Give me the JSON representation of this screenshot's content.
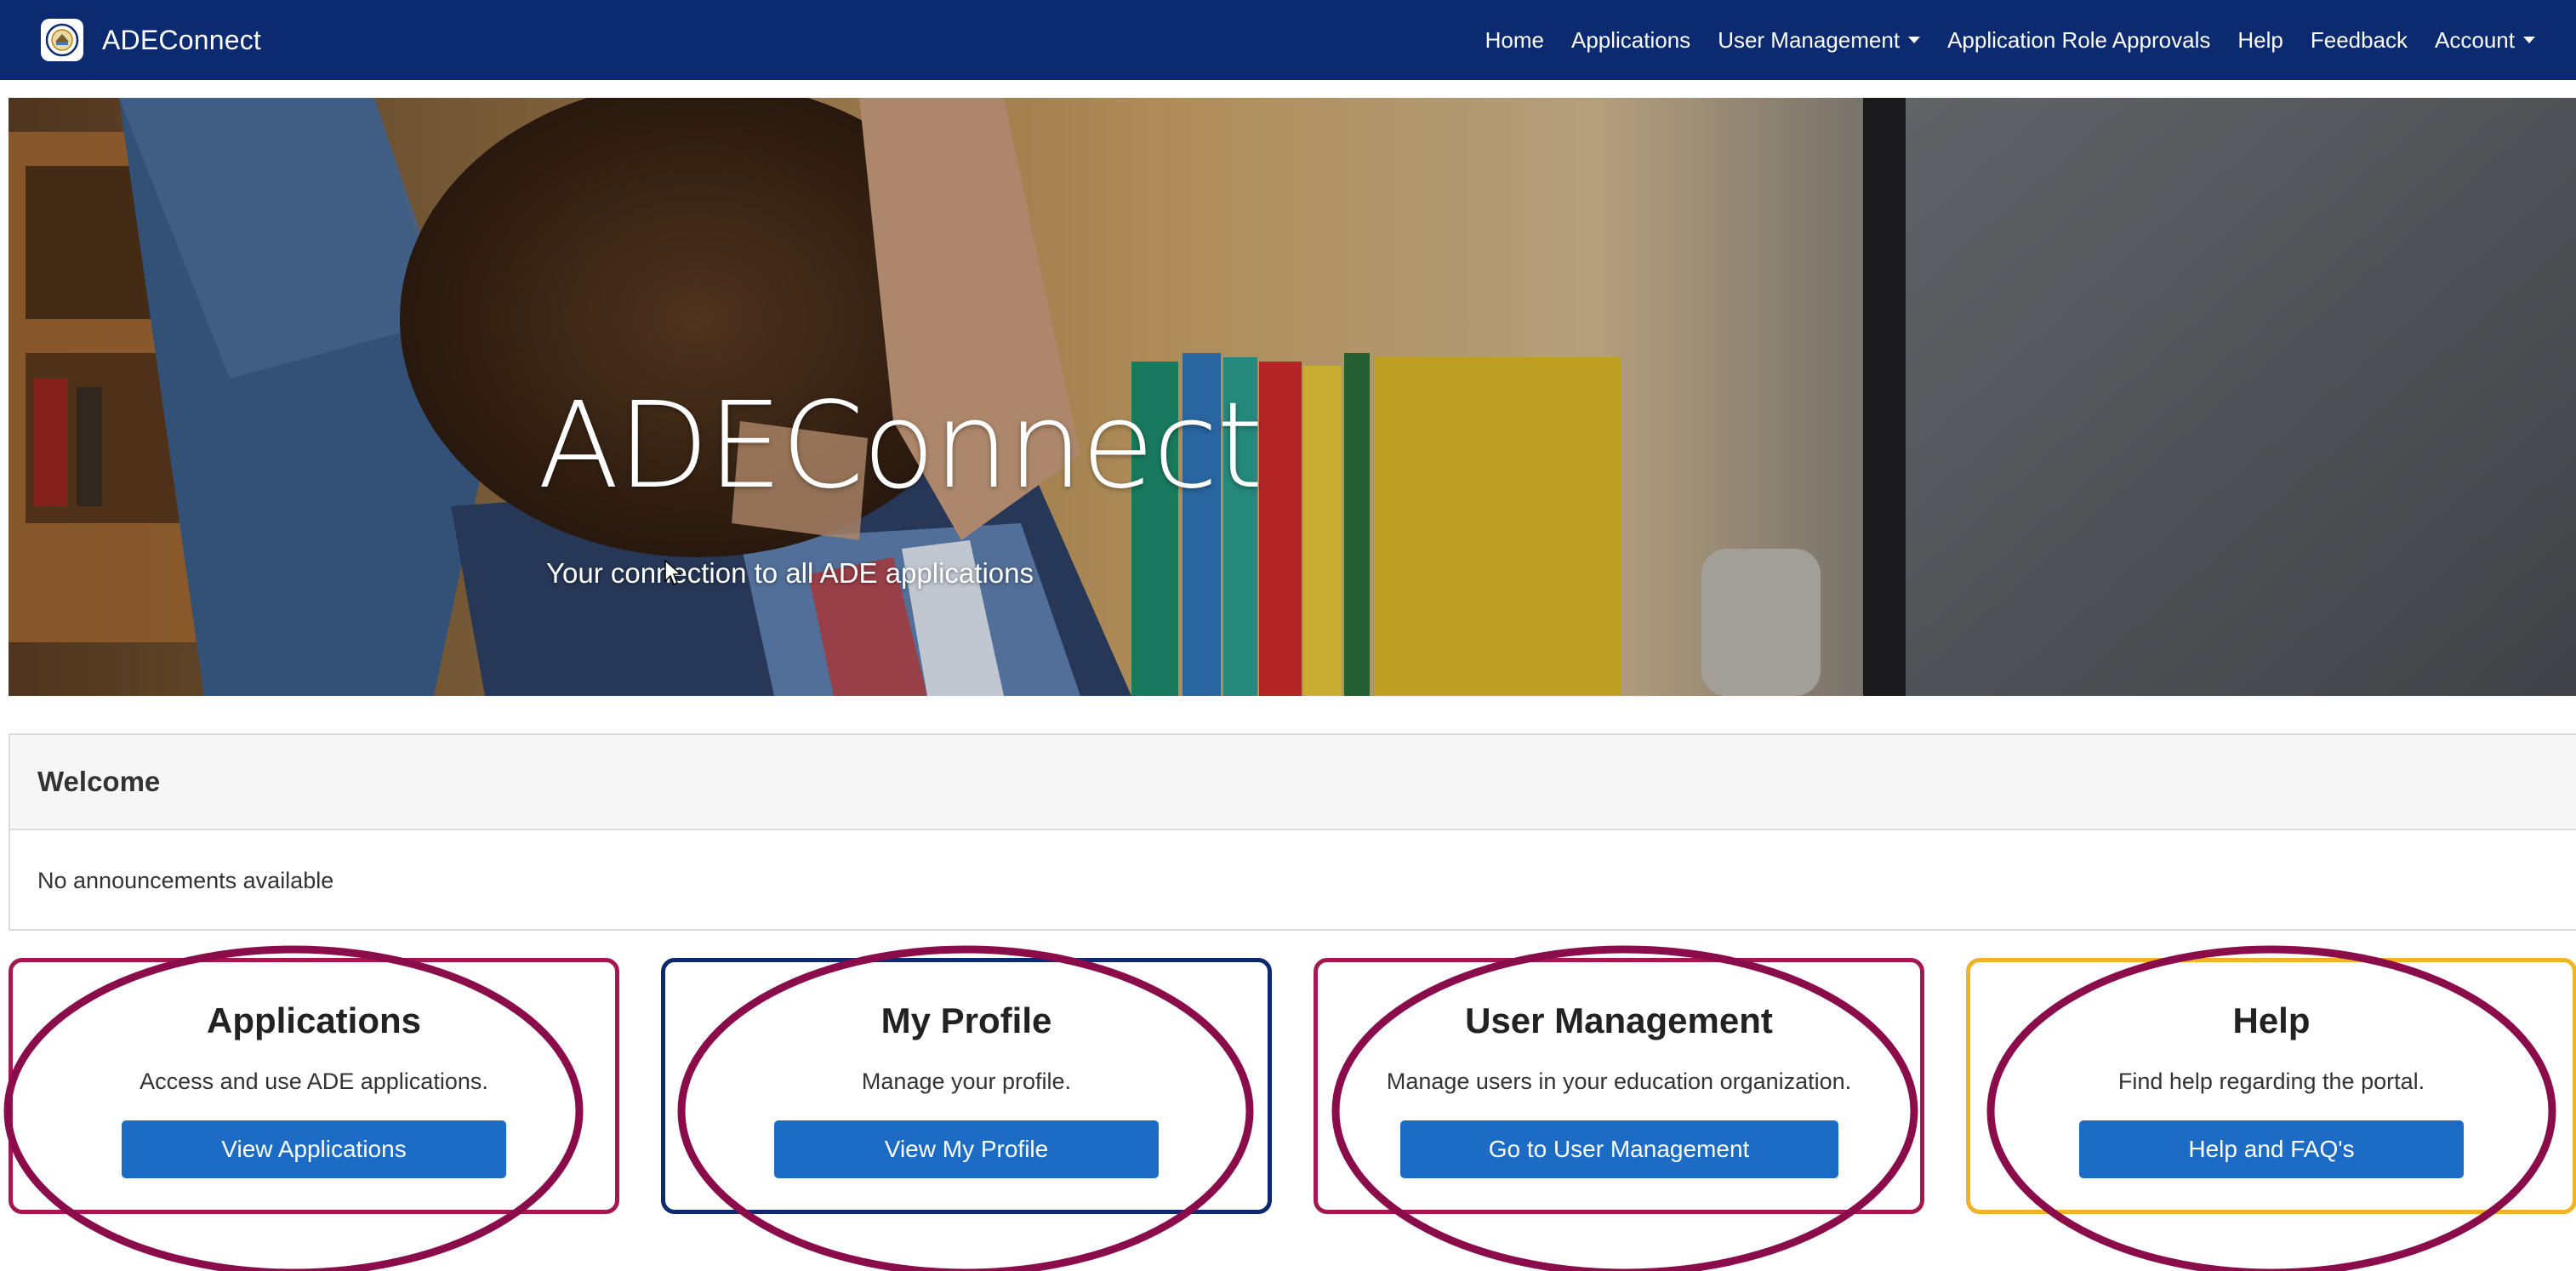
{
  "navbar": {
    "brand": "ADEConnect",
    "links": {
      "home": "Home",
      "applications": "Applications",
      "user_management": "User Management",
      "role_approvals": "Application Role Approvals",
      "help": "Help",
      "feedback": "Feedback",
      "account": "Account"
    },
    "background_color": "#0b2a6f"
  },
  "hero": {
    "title": "ADEConnect",
    "subtitle": "Your connection to all ADE applications"
  },
  "welcome": {
    "heading": "Welcome",
    "message": "No announcements available"
  },
  "cards": [
    {
      "title": "Applications",
      "description": "Access and use ADE applications.",
      "button": "View Applications",
      "border_color": "#a4174f"
    },
    {
      "title": "My Profile",
      "description": "Manage your profile.",
      "button": "View My Profile",
      "border_color": "#0b2a6f"
    },
    {
      "title": "User Management",
      "description": "Manage users in your education organization.",
      "button": "Go to User Management",
      "border_color": "#a4174f"
    },
    {
      "title": "Help",
      "description": "Find help regarding the portal.",
      "button": "Help and FAQ's",
      "border_color": "#f0b323"
    }
  ],
  "colors": {
    "button_blue": "#1c6cc6",
    "annotation_oval": "#8a0c4a"
  },
  "icons": {
    "brand_logo": "state-seal-icon",
    "cursor": "mouse-pointer-icon"
  }
}
